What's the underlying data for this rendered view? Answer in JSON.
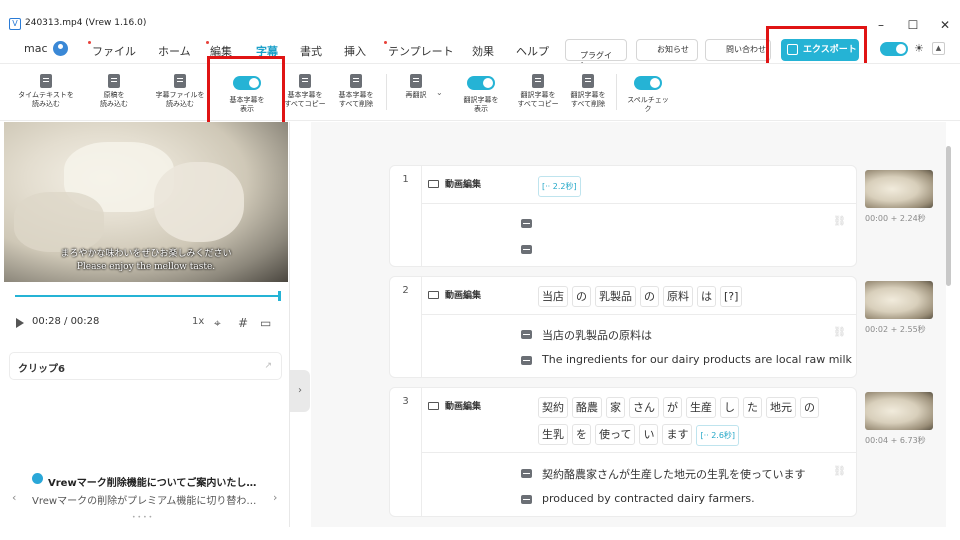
{
  "window": {
    "title": "240313.mp4 (Vrew 1.16.0)",
    "min": "–",
    "max": "☐",
    "close": "✕"
  },
  "menubar": {
    "user": "mac",
    "tabs": [
      "ファイル",
      "ホーム",
      "編集",
      "字幕",
      "書式",
      "挿入",
      "テンプレート",
      "効果",
      "ヘルプ"
    ],
    "active_tab": "字幕",
    "plugin_label": "プラグイ\nン",
    "notice_label": "お知らせ",
    "contact_label": "問い合わせ",
    "export_label": "エクスポート"
  },
  "toolbar": {
    "items": [
      "タイムテキストを\n読み込む",
      "原稿を\n読み込む",
      "字幕ファイルを\n読み込む",
      "基本字幕を\n表示",
      "基本字幕を\nすべてコピー",
      "基本字幕を\nすべて削除",
      "再翻訳",
      "翻訳字幕を\n表示",
      "翻訳字幕を\nすべてコピー",
      "翻訳字幕を\nすべて削除",
      "スペルチェッ\nク"
    ]
  },
  "player": {
    "subtitle_jp": "まろやかな味わいをぜひお楽しみください",
    "subtitle_en": "Please enjoy the mellow taste.",
    "time_current": "00:28",
    "time_total": "/ 00:28",
    "speed": "1x",
    "progress": 1.0
  },
  "clip_panel": {
    "title": "クリップ6"
  },
  "notice": {
    "title": "Vrewマーク削除機能についてご案内いたし…",
    "body": "Vrewマークの削除がプレミアム機能に切り替わ…"
  },
  "clips": [
    {
      "num": "1",
      "header": "動画編集",
      "tokens": [
        {
          "t": "[·· 2.2秒]",
          "gap": true
        }
      ],
      "jp": "",
      "en": "",
      "timestamp": "00:00 + 2.24秒"
    },
    {
      "num": "2",
      "header": "動画編集",
      "tokens": [
        {
          "t": "当店"
        },
        {
          "t": "の"
        },
        {
          "t": "乳製品"
        },
        {
          "t": "の"
        },
        {
          "t": "原料"
        },
        {
          "t": "は"
        },
        {
          "t": "[?]"
        }
      ],
      "jp": "当店の乳製品の原料は",
      "en": "The ingredients for our dairy products are local raw milk",
      "timestamp": "00:02 + 2.55秒"
    },
    {
      "num": "3",
      "header": "動画編集",
      "tokens": [
        {
          "t": "契約"
        },
        {
          "t": "酪農"
        },
        {
          "t": "家"
        },
        {
          "t": "さん"
        },
        {
          "t": "が"
        },
        {
          "t": "生産"
        },
        {
          "t": "し"
        },
        {
          "t": "た"
        },
        {
          "t": "地元"
        },
        {
          "t": "の"
        },
        {
          "t": "生乳"
        },
        {
          "t": "を"
        },
        {
          "t": "使って"
        },
        {
          "t": "い"
        },
        {
          "t": "ます"
        },
        {
          "t": "[·· 2.6秒]",
          "gap": true
        }
      ],
      "jp": "契約酪農家さんが生産した地元の生乳を使っています",
      "en": "produced by contracted dairy farmers.",
      "timestamp": "00:04 + 6.73秒"
    }
  ],
  "colors": {
    "accent": "#25b3d5",
    "highlight": "#e01414"
  }
}
